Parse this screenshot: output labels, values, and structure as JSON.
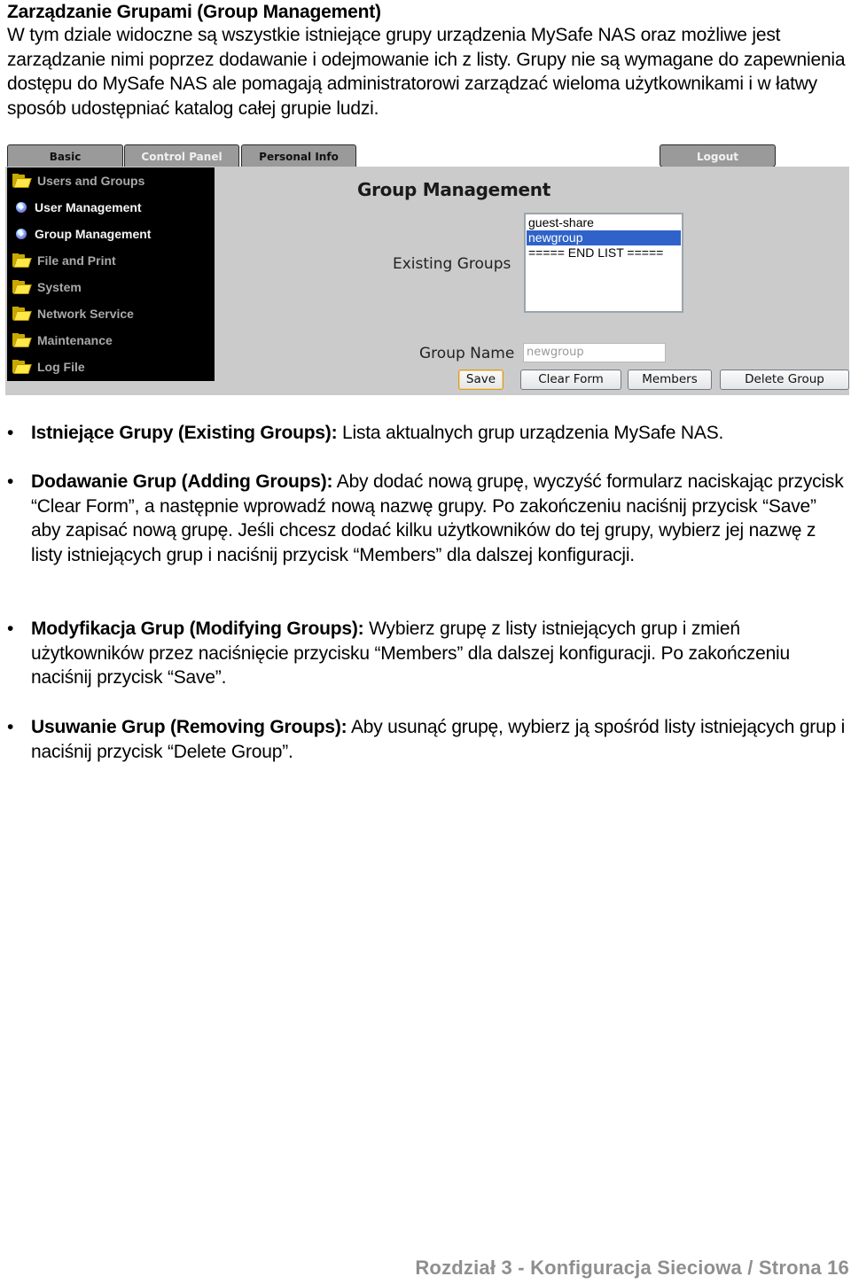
{
  "document": {
    "title": "Zarządzanie Grupami (Group Management)",
    "intro": "W tym dziale widoczne są wszystkie istniejące grupy urządzenia MySafe NAS oraz możliwe jest zarządzanie nimi poprzez dodawanie i odejmowanie ich z listy. Grupy nie są wymagane do zapewnienia dostępu do MySafe NAS ale pomagają administratorowi zarządzać wieloma użytkownikami i w łatwy sposób udostępniać katalog całej grupie ludzi.",
    "bullets": [
      {
        "term": "Istniejące Grupy (Existing Groups):",
        "text": " Lista aktualnych grup urządzenia MySafe NAS."
      },
      {
        "term": "Dodawanie Grup (Adding Groups):",
        "text": " Aby dodać nową grupę, wyczyść formularz naciskając przycisk “Clear Form”, a następnie wprowadź nową nazwę grupy. Po zakończeniu naciśnij przycisk “Save” aby zapisać nową grupę. Jeśli chcesz dodać kilku użytkowników do tej grupy, wybierz jej nazwę z listy istniejących grup i naciśnij przycisk “Members” dla dalszej konfiguracji."
      },
      {
        "term": "Modyfikacja Grup (Modifying Groups):",
        "text": " Wybierz grupę z listy istniejących grup i zmień użytkowników przez naciśnięcie przycisku  “Members” dla dalszej konfiguracji. Po zakończeniu naciśnij przycisk “Save”."
      },
      {
        "term": "Usuwanie Grup (Removing Groups):",
        "text": " Aby usunąć grupę, wybierz ją spośród listy istniejących grup i naciśnij przycisk “Delete Group”."
      }
    ],
    "bullet_glyph": "•",
    "footer": "Rozdział 3 - Konfiguracja Sieciowa  /  Strona 16"
  },
  "screenshot": {
    "tabs": {
      "basic": "Basic",
      "control_panel": "Control Panel",
      "personal_info": "Personal Info",
      "logout": "Logout",
      "active": "control_panel"
    },
    "sidebar": [
      {
        "label": "Users and Groups",
        "icon": "folder-icon"
      },
      {
        "label": "User Management",
        "icon": "page-bullet-icon"
      },
      {
        "label": "Group Management",
        "icon": "page-bullet-icon"
      },
      {
        "label": "File and Print",
        "icon": "folder-icon"
      },
      {
        "label": "System",
        "icon": "folder-icon"
      },
      {
        "label": "Network Service",
        "icon": "folder-icon"
      },
      {
        "label": "Maintenance",
        "icon": "folder-icon"
      },
      {
        "label": "Log File",
        "icon": "folder-icon"
      }
    ],
    "panel_title": "Group Management",
    "existing_groups_label": "Existing Groups",
    "existing_groups": [
      "guest-share",
      "newgroup",
      "===== END LIST ====="
    ],
    "selected_group": "newgroup",
    "group_name_label": "Group Name",
    "group_name_value": "newgroup",
    "buttons": {
      "save": "Save",
      "clear": "Clear Form",
      "members": "Members",
      "delete": "Delete Group"
    },
    "colors": {
      "selection": "#3063c9",
      "panel_bg": "#cbcbcb",
      "sidebar_bg": "#000000",
      "tab_bg": "#9a9a9a"
    }
  }
}
